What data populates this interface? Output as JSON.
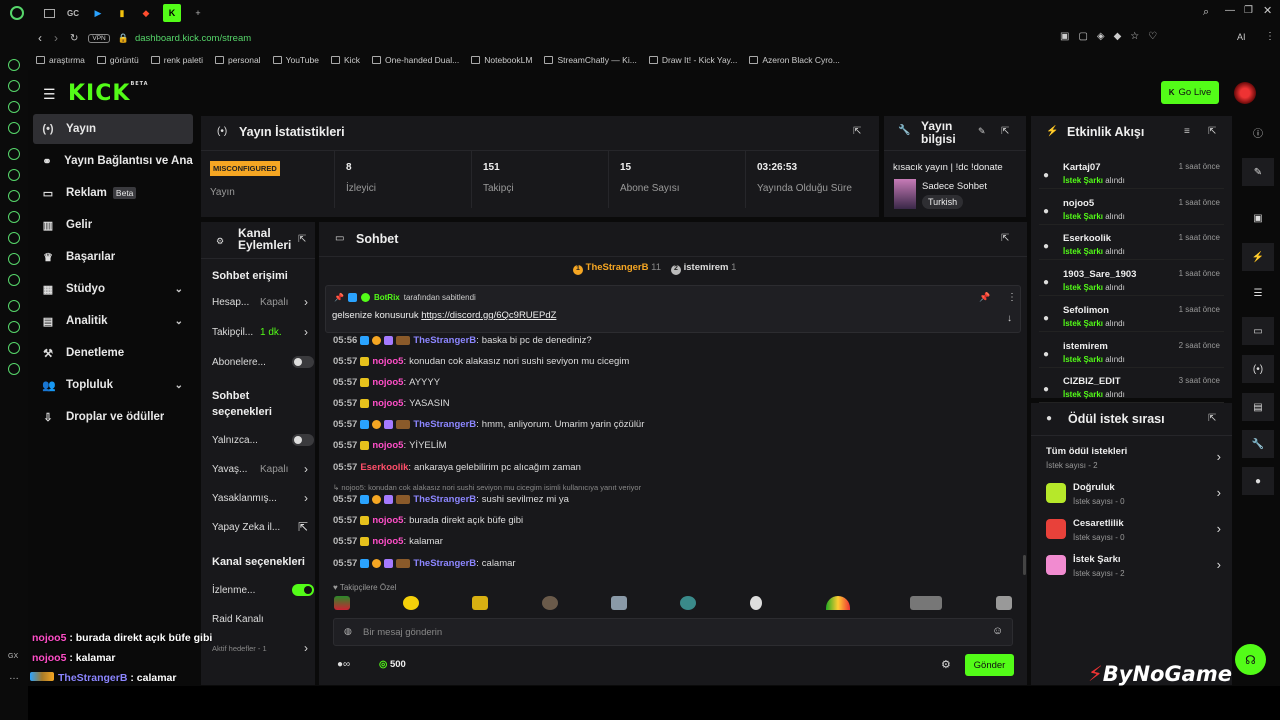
{
  "browser": {
    "url": "dashboard.kick.com/stream",
    "vpn": "VPN",
    "tab_gc": "GC",
    "ai_label": "AI",
    "bookmarks": [
      "araştırma",
      "görüntü",
      "renk paleti",
      "personal",
      "YouTube",
      "Kick",
      "One-handed Dual...",
      "NotebookLM",
      "StreamChatly — Ki...",
      "Draw It! - Kick Yay...",
      "Azeron Black Cyro..."
    ]
  },
  "header": {
    "logo": "KICK",
    "logo_sup": "BETA",
    "go_live": "Go Live"
  },
  "sidebar": {
    "items": [
      {
        "label": "Yayın",
        "icon": "broadcast-icon"
      },
      {
        "label": "Yayın Bağlantısı ve Anahtarı",
        "icon": "link-icon"
      },
      {
        "label": "Reklam",
        "badge": "Beta",
        "icon": "ad-icon"
      },
      {
        "label": "Gelir",
        "icon": "revenue-icon"
      },
      {
        "label": "Başarılar",
        "icon": "trophy-icon"
      },
      {
        "label": "Stüdyo",
        "icon": "studio-icon"
      },
      {
        "label": "Analitik",
        "icon": "analytics-icon"
      },
      {
        "label": "Denetleme",
        "icon": "hammer-icon"
      },
      {
        "label": "Topluluk",
        "icon": "community-icon"
      },
      {
        "label": "Droplar ve ödüller",
        "icon": "drops-icon"
      }
    ]
  },
  "stats": {
    "title": "Yayın İstatistikleri",
    "status_badge": "MISCONFIGURED",
    "status_label": "Yayın",
    "items": [
      {
        "value": "8",
        "label": "İzleyici"
      },
      {
        "value": "151",
        "label": "Takipçi"
      },
      {
        "value": "15",
        "label": "Abone Sayısı"
      },
      {
        "value": "03:26:53",
        "label": "Yayında Olduğu Süre"
      }
    ]
  },
  "stream_info": {
    "title": "Yayın bilgisi",
    "stream_title": "kısacık yayın | !dc !donate",
    "category": "Sadece Sohbet",
    "language": "Turkish"
  },
  "events": {
    "title": "Etkinlik Akışı",
    "items": [
      {
        "name": "Kartaj07",
        "reward": "İstek Şarkı",
        "suffix": "alındı",
        "time": "1 saat önce"
      },
      {
        "name": "nojoo5",
        "reward": "İstek Şarkı",
        "suffix": "alındı",
        "time": "1 saat önce"
      },
      {
        "name": "Eserkoolik",
        "reward": "İstek Şarkı",
        "suffix": "alındı",
        "time": "1 saat önce"
      },
      {
        "name": "1903_Sare_1903",
        "reward": "İstek Şarkı",
        "suffix": "alındı",
        "time": "1 saat önce"
      },
      {
        "name": "Sefolimon",
        "reward": "İstek Şarkı",
        "suffix": "alındı",
        "time": "1 saat önce"
      },
      {
        "name": "istemirem",
        "reward": "İstek Şarkı",
        "suffix": "alındı",
        "time": "2 saat önce"
      },
      {
        "name": "CIZBIZ_EDIT",
        "reward": "İstek Şarkı",
        "suffix": "alındı",
        "time": "3 saat önce"
      }
    ]
  },
  "rewards": {
    "title": "Ödül istek sırası",
    "items": [
      {
        "name": "Tüm ödül istekleri",
        "count": "İstek sayısı - 2",
        "color": ""
      },
      {
        "name": "Doğruluk",
        "count": "İstek sayısı - 0",
        "color": "#b6e82a"
      },
      {
        "name": "Cesaretlilik",
        "count": "İstek sayısı - 0",
        "color": "#e8413a"
      },
      {
        "name": "İstek Şarkı",
        "count": "İstek sayısı - 2",
        "color": "#f18bd0"
      }
    ]
  },
  "channel_actions": {
    "title": "Kanal Eylemleri",
    "chat_access": "Sohbet erişimi",
    "rows1": [
      {
        "label": "Hesap...",
        "value": "Kapalı"
      },
      {
        "label": "Takipçil...",
        "value": "1 dk."
      },
      {
        "label": "Abonelere...",
        "value": ""
      }
    ],
    "chat_options": "Sohbet seçenekleri",
    "rows2": [
      {
        "label": "Yalnızca...",
        "value": ""
      },
      {
        "label": "Yavaş...",
        "value": "Kapalı"
      },
      {
        "label": "Yasaklanmış...",
        "value": ""
      },
      {
        "label": "Yapay Zeka il...",
        "value": ""
      }
    ],
    "channel_options": "Kanal seçenekleri",
    "rows3": [
      {
        "label": "İzlenme...",
        "value": ""
      },
      {
        "label": "Raid Kanalı",
        "value": ""
      },
      {
        "label": "Aktif hedefler - 1",
        "value": ""
      }
    ]
  },
  "chat": {
    "title": "Sohbet",
    "top": [
      {
        "name": "TheStrangerB",
        "count": "11"
      },
      {
        "name": "istemirem",
        "count": "1"
      }
    ],
    "pinned_by": "BotRix",
    "pinned_suffix": "tarafından sabitlendi",
    "pinned_text": "gelsenize konusuruk",
    "pinned_link": "https://discord.gg/6Qc9RUEPdZ",
    "messages": [
      {
        "time": "05:56",
        "user": "TheStrangerB",
        "color": "#8c86ff",
        "text": "baska bi pc de denediniz?"
      },
      {
        "time": "05:57",
        "user": "nojoo5",
        "color": "#ff4fc8",
        "text": "konudan cok alakasız nori sushi seviyon mu cicegim"
      },
      {
        "time": "05:57",
        "user": "nojoo5",
        "color": "#ff4fc8",
        "text": "AYYYY"
      },
      {
        "time": "05:57",
        "user": "nojoo5",
        "color": "#ff4fc8",
        "text": "YASASIN"
      },
      {
        "time": "05:57",
        "user": "TheStrangerB",
        "color": "#8c86ff",
        "text": "hmm, anliyorum. Umarim yarin çözülür"
      },
      {
        "time": "05:57",
        "user": "nojoo5",
        "color": "#ff4fc8",
        "text": "YİYELİM"
      },
      {
        "time": "05:57",
        "user": "Eserkoolik",
        "color": "#ff4f6a",
        "text": "ankaraya gelebilirim pc alıcağım zaman"
      },
      {
        "time": "05:57",
        "user": "TheStrangerB",
        "color": "#8c86ff",
        "text": "sushi sevilmez mi ya"
      },
      {
        "time": "05:57",
        "user": "nojoo5",
        "color": "#ff4fc8",
        "text": "burada direkt açık büfe gibi"
      },
      {
        "time": "05:57",
        "user": "nojoo5",
        "color": "#ff4fc8",
        "text": "kalamar"
      },
      {
        "time": "05:57",
        "user": "TheStrangerB",
        "color": "#8c86ff",
        "text": "calamar"
      }
    ],
    "reply_hint": "nojoo5: konudan cok alakasız nori sushi seviyon mu cicegim isimli kullanıcıya yanıt veriyor",
    "emote_label": "Takipçilere Özel",
    "input_placeholder": "Bir mesaj gönderin",
    "points": "500",
    "send": "Gönder"
  },
  "overlay": {
    "messages": [
      {
        "user": "nojoo5",
        "text": "burada direkt açık büfe gibi"
      },
      {
        "user": "nojoo5",
        "text": "kalamar"
      },
      {
        "user": "TheStrangerB",
        "text": "calamar"
      }
    ]
  },
  "watermark": "ByNoGame"
}
